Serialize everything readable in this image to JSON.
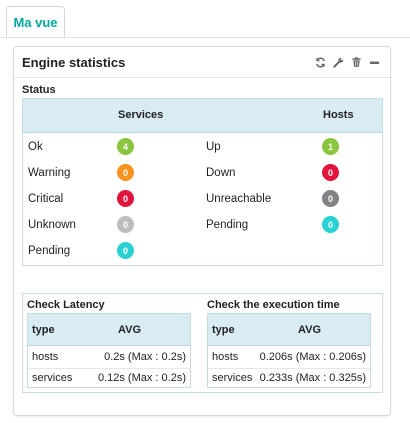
{
  "tabs": [
    {
      "label": "Ma vue"
    }
  ],
  "widget": {
    "title": "Engine statistics",
    "tools": [
      "refresh-icon",
      "wrench-icon",
      "trash-icon",
      "minimize-icon"
    ],
    "status_label": "Status",
    "headers": {
      "services": "Services",
      "hosts": "Hosts"
    },
    "rows": [
      {
        "service_label": "Ok",
        "service_count": "4",
        "service_color": "#8cc63e",
        "host_label": "Up",
        "host_count": "1",
        "host_color": "#8cc63e"
      },
      {
        "service_label": "Warning",
        "service_count": "0",
        "service_color": "#f7931e",
        "host_label": "Down",
        "host_count": "0",
        "host_color": "#e0143c"
      },
      {
        "service_label": "Critical",
        "service_count": "0",
        "service_color": "#e0143c",
        "host_label": "Unreachable",
        "host_count": "0",
        "host_color": "#818285"
      },
      {
        "service_label": "Unknown",
        "service_count": "0",
        "service_color": "#bcbdc0",
        "host_label": "Pending",
        "host_count": "0",
        "host_color": "#2ad1d4"
      },
      {
        "service_label": "Pending",
        "service_count": "0",
        "service_color": "#2ad1d4",
        "host_label": "",
        "host_count": "",
        "host_color": ""
      }
    ],
    "latency": {
      "title": "Check Latency",
      "col_type": "type",
      "col_avg": "AVG",
      "rows": [
        {
          "type": "hosts",
          "avg": "0.2s (Max : 0.2s)"
        },
        {
          "type": "services",
          "avg": "0.12s (Max : 0.2s)"
        }
      ]
    },
    "execution": {
      "title": "Check the execution time",
      "col_type": "type",
      "col_avg": "AVG",
      "rows": [
        {
          "type": "hosts",
          "avg": "0.206s (Max : 0.206s)"
        },
        {
          "type": "services",
          "avg": "0.233s (Max : 0.325s)"
        }
      ]
    }
  }
}
